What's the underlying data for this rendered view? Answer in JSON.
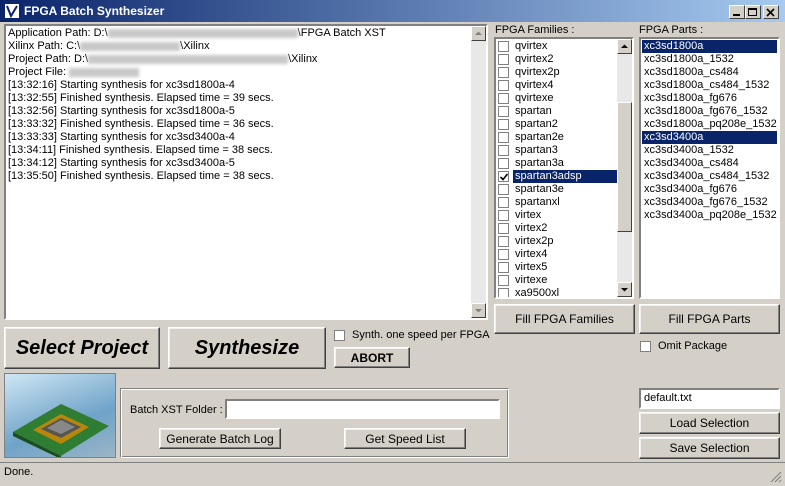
{
  "window": {
    "title": "FPGA Batch Synthesizer"
  },
  "log": {
    "lines": [
      {
        "prefix": "Application Path: D:\\",
        "suffix": "\\FPGA Batch XST",
        "blur": 190
      },
      {
        "prefix": "Xilinx Path: C:\\",
        "suffix": "\\Xilinx",
        "blur": 100
      },
      {
        "prefix": "Project Path: D:\\",
        "suffix": "\\Xilinx",
        "blur": 200
      },
      {
        "prefix": "Project File: ",
        "suffix": "",
        "blur": 70
      },
      {
        "text": "[13:32:16] Starting synthesis for xc3sd1800a-4"
      },
      {
        "text": "[13:32:55] Finished synthesis. Elapsed time = 39 secs."
      },
      {
        "text": "[13:32:56] Starting synthesis for xc3sd1800a-5"
      },
      {
        "text": "[13:33:32] Finished synthesis. Elapsed time = 36 secs."
      },
      {
        "text": "[13:33:33] Starting synthesis for xc3sd3400a-4"
      },
      {
        "text": "[13:34:11] Finished synthesis. Elapsed time = 38 secs."
      },
      {
        "text": "[13:34:12] Starting synthesis for xc3sd3400a-5"
      },
      {
        "text": "[13:35:50] Finished synthesis. Elapsed time = 38 secs."
      }
    ]
  },
  "families": {
    "label": "FPGA Families :",
    "items": [
      {
        "name": "qvirtex",
        "checked": false,
        "selected": false
      },
      {
        "name": "qvirtex2",
        "checked": false,
        "selected": false
      },
      {
        "name": "qvirtex2p",
        "checked": false,
        "selected": false
      },
      {
        "name": "qvirtex4",
        "checked": false,
        "selected": false
      },
      {
        "name": "qvirtexe",
        "checked": false,
        "selected": false
      },
      {
        "name": "spartan",
        "checked": false,
        "selected": false
      },
      {
        "name": "spartan2",
        "checked": false,
        "selected": false
      },
      {
        "name": "spartan2e",
        "checked": false,
        "selected": false
      },
      {
        "name": "spartan3",
        "checked": false,
        "selected": false
      },
      {
        "name": "spartan3a",
        "checked": false,
        "selected": false
      },
      {
        "name": "spartan3adsp",
        "checked": true,
        "selected": true
      },
      {
        "name": "spartan3e",
        "checked": false,
        "selected": false
      },
      {
        "name": "spartanxl",
        "checked": false,
        "selected": false
      },
      {
        "name": "virtex",
        "checked": false,
        "selected": false
      },
      {
        "name": "virtex2",
        "checked": false,
        "selected": false
      },
      {
        "name": "virtex2p",
        "checked": false,
        "selected": false
      },
      {
        "name": "virtex4",
        "checked": false,
        "selected": false
      },
      {
        "name": "virtex5",
        "checked": false,
        "selected": false
      },
      {
        "name": "virtexe",
        "checked": false,
        "selected": false
      },
      {
        "name": "xa9500xl",
        "checked": false,
        "selected": false
      }
    ]
  },
  "parts": {
    "label": "FPGA Parts :",
    "items": [
      {
        "name": "xc3sd1800a",
        "selected": true
      },
      {
        "name": "xc3sd1800a_1532",
        "selected": false
      },
      {
        "name": "xc3sd1800a_cs484",
        "selected": false
      },
      {
        "name": "xc3sd1800a_cs484_1532",
        "selected": false
      },
      {
        "name": "xc3sd1800a_fg676",
        "selected": false
      },
      {
        "name": "xc3sd1800a_fg676_1532",
        "selected": false
      },
      {
        "name": "xc3sd1800a_pq208e_1532",
        "selected": false
      },
      {
        "name": "xc3sd3400a",
        "selected": true
      },
      {
        "name": "xc3sd3400a_1532",
        "selected": false
      },
      {
        "name": "xc3sd3400a_cs484",
        "selected": false
      },
      {
        "name": "xc3sd3400a_cs484_1532",
        "selected": false
      },
      {
        "name": "xc3sd3400a_fg676",
        "selected": false
      },
      {
        "name": "xc3sd3400a_fg676_1532",
        "selected": false
      },
      {
        "name": "xc3sd3400a_pq208e_1532",
        "selected": false
      }
    ]
  },
  "buttons": {
    "select_project": "Select Project",
    "synthesize": "Synthesize",
    "abort": "ABORT",
    "fill_families": "Fill FPGA Families",
    "fill_parts": "Fill FPGA Parts",
    "generate_log": "Generate Batch Log",
    "get_speed": "Get Speed List",
    "load_selection": "Load Selection",
    "save_selection": "Save Selection"
  },
  "options": {
    "one_speed_label": "Synth. one speed per FPGA",
    "one_speed_checked": false,
    "omit_package_label": "Omit Package",
    "omit_package_checked": false
  },
  "batch": {
    "folder_label": "Batch XST Folder :",
    "folder_value": ""
  },
  "selection_file": {
    "value": "default.txt"
  },
  "status": {
    "text": "Done."
  },
  "icons": {
    "app": "app-icon",
    "chip": "chip-image",
    "minimize": "minimize-icon",
    "maximize": "maximize-icon",
    "close": "close-icon"
  },
  "colors": {
    "selection": "#0a246a",
    "title_start": "#0a246a",
    "title_end": "#a6caf0",
    "face": "#d4d0c8"
  }
}
